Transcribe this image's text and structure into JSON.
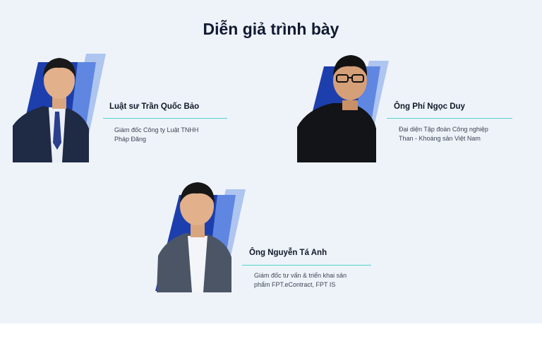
{
  "page": {
    "title": "Diễn giả trình bày"
  },
  "speakers": [
    {
      "name": "Luật sư Trần Quốc Bảo",
      "role_lines": [
        "Giám đốc Công ty Luật TNHH",
        "Pháp Đăng"
      ]
    },
    {
      "name": "Ông Phí Ngọc Duy",
      "role_lines": [
        "Đại diện Tập đoàn Công nghiệp",
        "Than - Khoáng sản Việt Nam"
      ]
    },
    {
      "name": "Ông Nguyễn Tá Anh",
      "role_lines": [
        "Giám đốc tư vấn & triển khai sản",
        "phẩm FPT.eContract, FPT IS"
      ]
    }
  ],
  "colors": {
    "background": "#eef3fa",
    "accent_line": "#4fd3cf",
    "frame_dark": "#1d3fae",
    "frame_light": "#7a9ee8",
    "title": "#121a33"
  }
}
